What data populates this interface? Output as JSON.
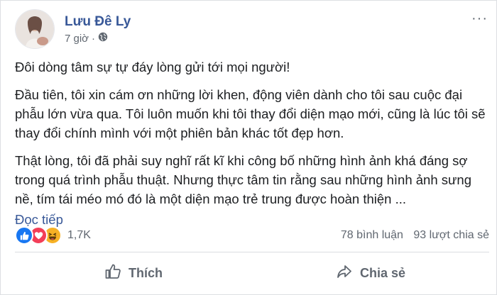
{
  "post": {
    "author": "Lưu Đê Ly",
    "time": "7 giờ",
    "privacy_icon": "globe-icon",
    "paragraphs": [
      "Đôi dòng tâm sự tự đáy lòng gửi tới mọi người!",
      "Đầu tiên, tôi xin cám ơn những lời khen, động viên dành cho tôi sau cuộc đại phẫu lớn vừa qua. Tôi luôn muốn khi tôi thay đổi diện mạo mới, cũng là lúc tôi sẽ thay đổi chính mình với một phiên bản khác tốt đẹp hơn.",
      "Thật lòng, tôi đã phải suy nghĩ rất kĩ khi công bố những hình ảnh khá đáng sợ trong quá trình phẫu thuật. Nhưng thực tâm tin rằng sau những hình ảnh sưng nề, tím tái méo mó đó là một diện mạo trẻ trung được hoàn thiện ..."
    ],
    "read_more": "Đọc tiếp"
  },
  "stats": {
    "reactions": [
      "like-icon",
      "love-icon",
      "haha-icon"
    ],
    "reaction_count": "1,7K",
    "comments": "78 bình luận",
    "shares": "93 lượt chia sẻ"
  },
  "actions": {
    "like_label": "Thích",
    "share_label": "Chia sẻ"
  },
  "colors": {
    "name_blue": "#385898",
    "like_blue": "#1877f2",
    "love_red": "#f33e58",
    "haha_yellow": "#f7b125",
    "secondary_text": "#606770"
  }
}
